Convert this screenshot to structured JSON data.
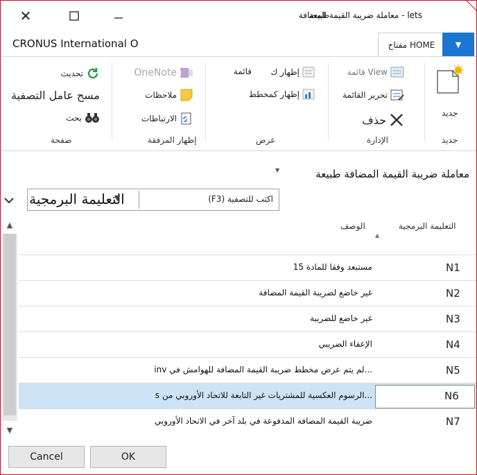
{
  "window": {
    "title": "lets - معاملة ضريبة القيمة المضافة",
    "kind": "طبيعة",
    "company": "CRONUS International O"
  },
  "ribbon": {
    "home_tab": "مفتاح HOME",
    "new": {
      "label": "جديد",
      "group": "جديد"
    },
    "manage": {
      "view": "View قائمة",
      "edit_list": "تحرير القائمة",
      "delete": "حذف",
      "group": "الإدارة"
    },
    "view": {
      "show_as_list": "إظهار ك",
      "list": "قائمة",
      "show_as_chart": "إظهار كمخطط",
      "group": "عرض"
    },
    "attach": {
      "onenote": "OneNote",
      "notes": "ملاحظات",
      "links": "الارتباطات",
      "group": "إظهار المرفقة"
    },
    "page": {
      "refresh": "تحديث",
      "clear_filter": "مسح عامل التصفية",
      "find": "بحث",
      "group": "صفحة"
    }
  },
  "filter": {
    "breadcrumb": "معاملة ضريبة القيمة المضافة  طبيعة",
    "placeholder": "اكتب للتصفية (F3)",
    "field": "التعليمة البرمجية"
  },
  "grid": {
    "columns": {
      "code": "التعليمة البرمجية",
      "desc": "الوصف"
    },
    "rows": [
      {
        "code": "N1",
        "desc": "مستبعد وفقا للمادة 15"
      },
      {
        "code": "N2",
        "desc": "غير خاضع لضريبة القيمة المضافة"
      },
      {
        "code": "N3",
        "desc": "غير خاضع للضريبة"
      },
      {
        "code": "N4",
        "desc": "الإعفاء الضريبي"
      },
      {
        "code": "N5",
        "desc": "...لم يتم عرض مخطط ضريبة القيمة المضافة للهوامش في inv"
      },
      {
        "code": "N6",
        "desc": "...الرسوم العكسية للمشتريات غير التابعة للاتحاد الأوروبي من s"
      },
      {
        "code": "N7",
        "desc": "ضريبة القيمة المضافة المدفوعة في بلد آخر في الاتحاد الأوروبي"
      }
    ]
  },
  "buttons": {
    "ok": "OK",
    "cancel": "Cancel"
  },
  "colors": {
    "accent": "#1976d2",
    "selection": "#cce3f6",
    "border": "#c0102a"
  }
}
